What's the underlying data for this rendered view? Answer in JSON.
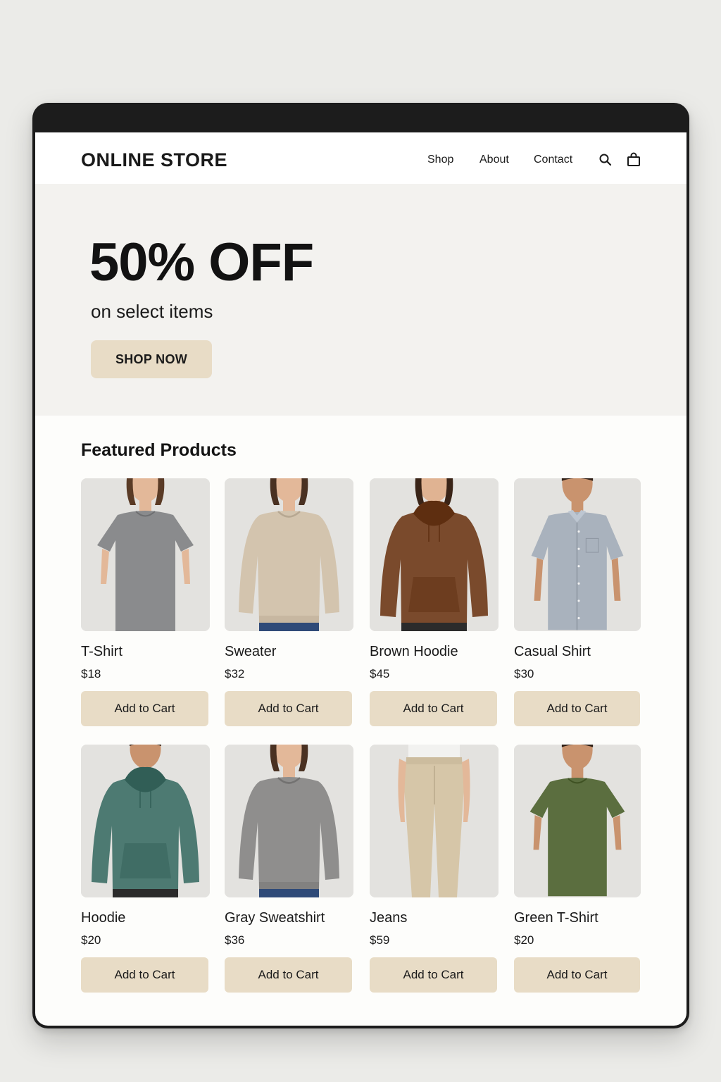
{
  "header": {
    "brand": "ONLINE STORE",
    "nav": [
      "Shop",
      "About",
      "Contact"
    ],
    "icons": [
      "search-icon",
      "shopping-bag-icon"
    ]
  },
  "hero": {
    "title": "50% OFF",
    "subtitle": "on select items",
    "cta": "SHOP NOW"
  },
  "featured": {
    "title": "Featured Products",
    "products": [
      {
        "name": "T-Shirt",
        "price": "$18",
        "button": "Add to Cart",
        "garment": "tee",
        "color": "#8a8b8d",
        "model": "woman",
        "skin": "#e3b899",
        "hair": "#5a3b26"
      },
      {
        "name": "Sweater",
        "price": "$32",
        "button": "Add to Cart",
        "garment": "sweater",
        "color": "#d3c4ae",
        "model": "woman",
        "skin": "#e3b899",
        "hair": "#4a3122"
      },
      {
        "name": "Brown Hoodie",
        "price": "$45",
        "button": "Add to Cart",
        "garment": "hoodie",
        "color": "#7a4a2c",
        "model": "woman",
        "skin": "#e0b392",
        "hair": "#3a2417"
      },
      {
        "name": "Casual Shirt",
        "price": "$30",
        "button": "Add to Cart",
        "garment": "shirt",
        "color": "#a9b2bd",
        "model": "man",
        "skin": "#c9936e",
        "hair": "#2e1f16"
      },
      {
        "name": "Hoodie",
        "price": "$20",
        "button": "Add to Cart",
        "garment": "hoodie",
        "color": "#4d7a72",
        "model": "man",
        "skin": "#c9936e",
        "hair": "#2e1f16"
      },
      {
        "name": "Gray Sweatshirt",
        "price": "$36",
        "button": "Add to Cart",
        "garment": "sweater",
        "color": "#8f8e8d",
        "model": "woman",
        "skin": "#e3b899",
        "hair": "#4a3122"
      },
      {
        "name": "Jeans",
        "price": "$59",
        "button": "Add to Cart",
        "garment": "pants",
        "color": "#d6c6a8",
        "model": "legs",
        "skin": "#e3b899",
        "hair": "#4a3122"
      },
      {
        "name": "Green T-Shirt",
        "price": "$20",
        "button": "Add to Cart",
        "garment": "tee",
        "color": "#5b6e3f",
        "model": "man",
        "skin": "#c9936e",
        "hair": "#2e1f16"
      }
    ]
  },
  "colors": {
    "accent_button": "#e8dcc6",
    "hero_background": "#f3f2ef",
    "text": "#1a1a1a"
  }
}
